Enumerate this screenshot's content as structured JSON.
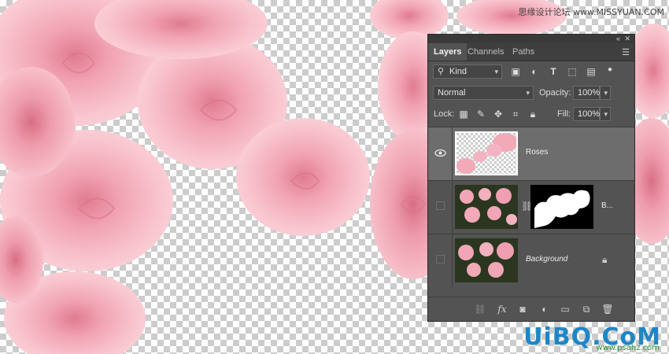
{
  "panel": {
    "collapse_icon": "double-chevron-icon",
    "close_icon": "close-icon",
    "menu_icon": "panel-menu-icon",
    "tabs": [
      {
        "label": "Layers",
        "active": true
      },
      {
        "label": "Channels",
        "active": false
      },
      {
        "label": "Paths",
        "active": false
      }
    ],
    "filter": {
      "kind_label": "Kind",
      "icons": [
        "image-filter-icon",
        "adjustment-filter-icon",
        "type-filter-icon",
        "shape-filter-icon",
        "smart-object-filter-icon",
        "filter-toggle-icon"
      ]
    },
    "blend": {
      "mode": "Normal",
      "opacity_label": "Opacity:",
      "opacity_value": "100%"
    },
    "lock": {
      "label": "Lock:",
      "fill_label": "Fill:",
      "fill_value": "100%",
      "icons": [
        "lock-transparent-icon",
        "lock-image-icon",
        "lock-position-icon",
        "lock-artboard-icon",
        "lock-all-icon"
      ]
    },
    "layers": [
      {
        "name": "Roses",
        "visible": true,
        "selected": true,
        "has_mask": false
      },
      {
        "name": "B...",
        "visible": false,
        "selected": false,
        "has_mask": true
      },
      {
        "name": "Background",
        "visible": false,
        "selected": false,
        "locked": true
      }
    ],
    "footer_icons": [
      "link-layers-icon",
      "fx-icon",
      "add-mask-icon",
      "adjustment-layer-icon",
      "new-group-icon",
      "new-layer-icon",
      "trash-icon"
    ],
    "fx_label": "fx"
  },
  "watermark": {
    "top": "思缘设计论坛 www.MISSYUAN.COM",
    "logo": "UiBQ.CoM",
    "url": "www.psahz.com"
  },
  "colors": {
    "panel_bg": "#535353",
    "selected_layer": "#6d6d6d",
    "rose_pink": "#f2a9b8",
    "logo_blue": "#1d86c7"
  }
}
